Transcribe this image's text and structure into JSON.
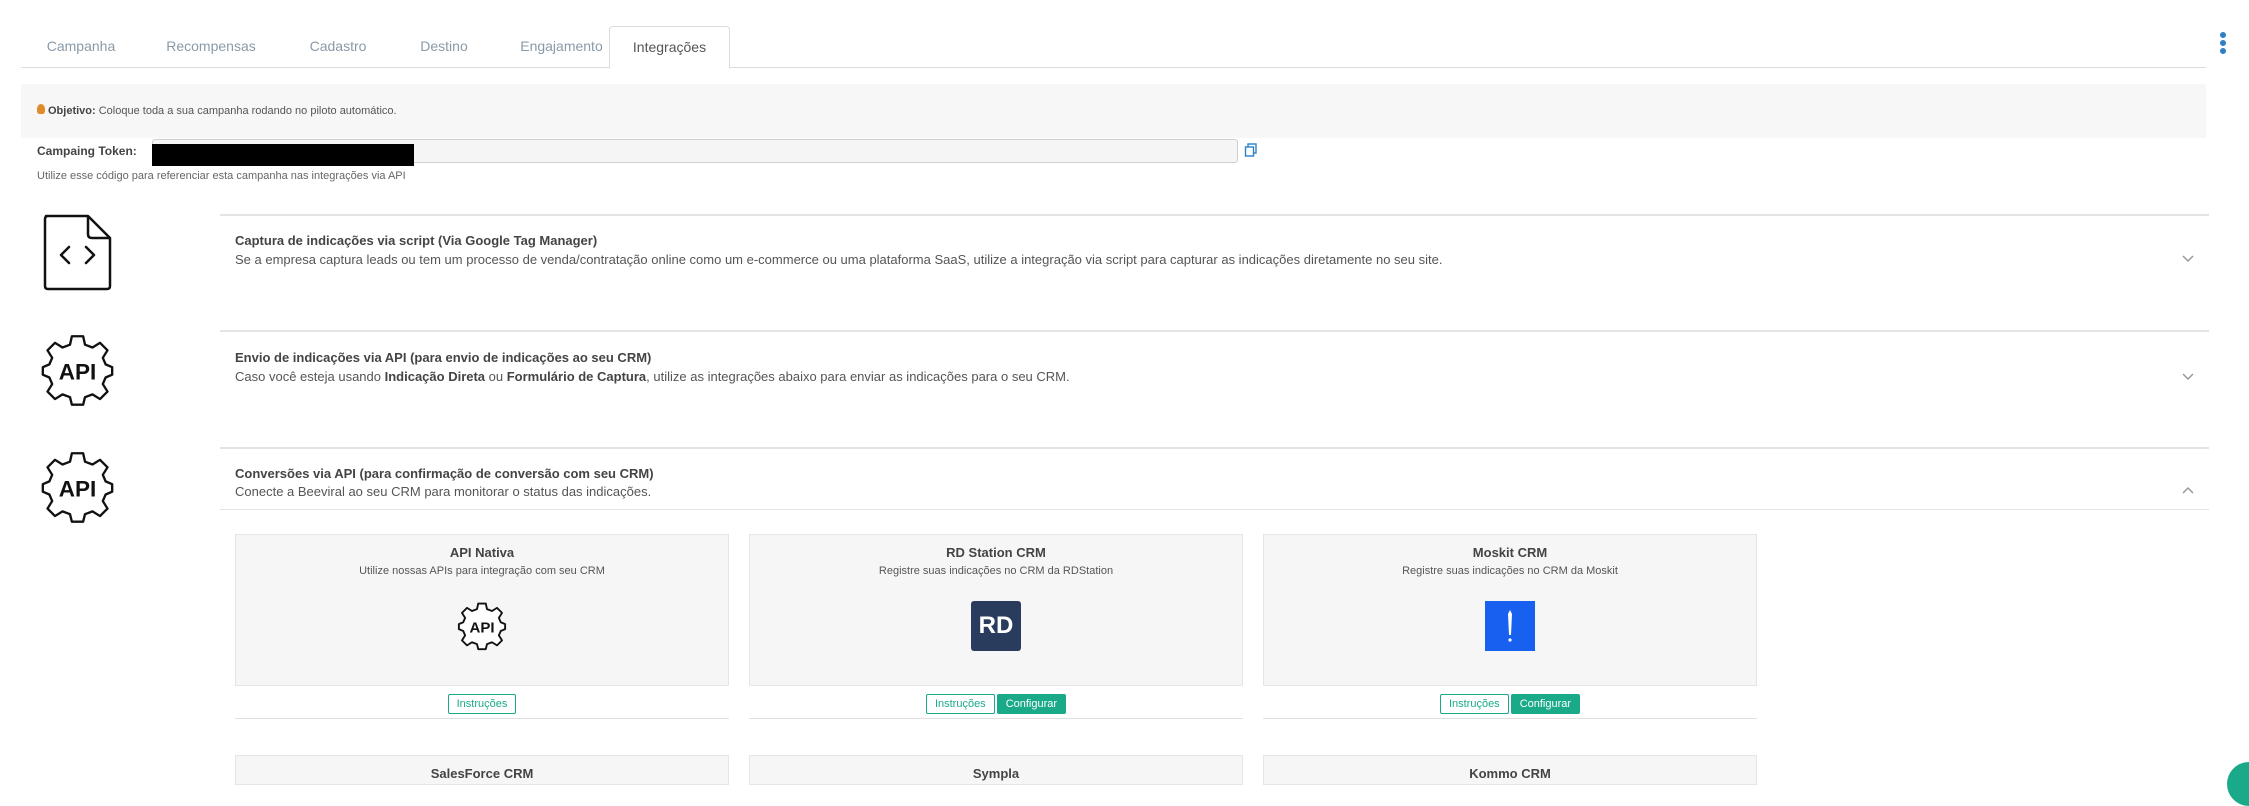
{
  "tabs": [
    {
      "label": "Campanha"
    },
    {
      "label": "Recompensas"
    },
    {
      "label": "Cadastro"
    },
    {
      "label": "Destino"
    },
    {
      "label": "Engajamento"
    },
    {
      "label": "Integrações",
      "active": true
    }
  ],
  "objective": {
    "label": "Objetivo:",
    "text": "Coloque toda a sua campanha rodando no piloto automático."
  },
  "token": {
    "label": "Campaing Token:",
    "help": "Utilize esse código para referenciar esta campanha nas integrações via API"
  },
  "sections": [
    {
      "icon": "code-file-icon",
      "title": "Captura de indicações via script (Via Google Tag Manager)",
      "description": "Se a empresa captura leads ou tem um processo de venda/contratação online como um e-commerce ou uma plataforma SaaS, utilize a integração via script para capturar as indicações diretamente no seu site.",
      "expanded": false
    },
    {
      "icon": "api-gear-icon",
      "title": "Envio de indicações via API (para envio de indicações ao seu CRM)",
      "description_parts": [
        "Caso você esteja usando ",
        "Indicação Direta",
        " ou ",
        "Formulário de Captura",
        ", utilize as integrações abaixo para enviar as indicações para o seu CRM."
      ],
      "expanded": false
    },
    {
      "icon": "api-gear-icon",
      "title": "Conversões via API (para confirmação de conversão com seu CRM)",
      "description": "Conecte a Beeviral ao seu CRM para monitorar o status das indicações.",
      "expanded": true
    }
  ],
  "cards": [
    {
      "title": "API Nativa",
      "description": "Utilize nossas APIs para integração com seu CRM",
      "logo": "api-gear-icon",
      "instructions_label": "Instruções"
    },
    {
      "title": "RD Station CRM",
      "description": "Registre suas indicações no CRM da RDStation",
      "logo": "rd-station-logo",
      "logo_text": "RD",
      "instructions_label": "Instruções",
      "configure_label": "Configurar"
    },
    {
      "title": "Moskit CRM",
      "description": "Registre suas indicações no CRM da Moskit",
      "logo": "moskit-logo",
      "instructions_label": "Instruções",
      "configure_label": "Configurar"
    }
  ],
  "next_cards": [
    {
      "title": "SalesForce CRM"
    },
    {
      "title": "Sympla"
    },
    {
      "title": "Kommo CRM"
    }
  ],
  "colors": {
    "accent": "#1aaa8a",
    "tab_text": "#8a9aa8",
    "kebab": "#2f80c8",
    "rd_logo_bg": "#2a3c5e",
    "moskit_logo_bg": "#1760f0"
  }
}
